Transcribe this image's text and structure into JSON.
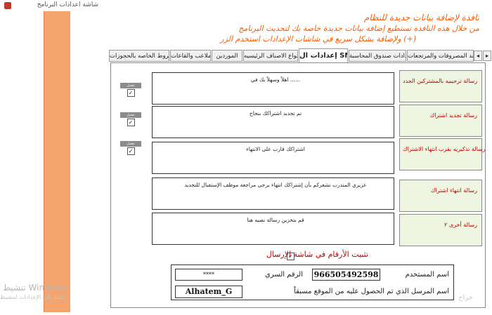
{
  "window": {
    "title": "شاشة اعدادات البرنامج"
  },
  "header": {
    "line1": "نافذة لإضافة بيانات جديدة للنظام",
    "line2": "من خلال هذه النافذة تستطيع إضافة بيانات جديدة خاصة بك لتحديث البرنامج",
    "line3": "ولإضافة بشكل سريع في شاشات الإعدادات استخدم الزر (+)"
  },
  "tabs": [
    {
      "label": "الشروط الخاصه بالحجوزات"
    },
    {
      "label": "الملاعب والقاعات"
    },
    {
      "label": "الموردين"
    },
    {
      "label": "انواع الاصناف الرئيسيه"
    },
    {
      "label": "إعدادات ال SMS",
      "active": true
    },
    {
      "label": "إعدادات صندوق المحاسبة"
    },
    {
      "label": "بند المصروفات والمرتجعات"
    }
  ],
  "nav": {
    "prev": "◂",
    "next": "▸"
  },
  "sms_messages": [
    {
      "label": "رسالة ترحيبيه بالمشتركين الجدد",
      "text": "اهلاً وسهلاً بك في ......",
      "has_toggle": true,
      "toggle_label": "تفعيل",
      "checked": true
    },
    {
      "label": "رسالة تجديد اشتراك",
      "text": "تم تجديد اشتراكك بنجاح",
      "has_toggle": true,
      "toggle_label": "تفعيل",
      "checked": true
    },
    {
      "label": "رسالة تذكيريه بقرب انتهاء الاشتراك",
      "text": "اشتراكك قارب على الانتهاء",
      "has_toggle": true,
      "toggle_label": "تفعيل",
      "checked": true
    },
    {
      "label": "رسالة انتهاء اشتراك",
      "text": "عزيزي المتدرب نشعركم بأن إشتراكك انتهاء يرجى مراجعة موظف الإستقبال للتجديد",
      "has_toggle": false
    },
    {
      "label": "رسالة أخرى ٢",
      "text": "قم بتخزين رسالة نصيه هنا",
      "has_toggle": false
    }
  ],
  "fix_numbers": {
    "label": "تثبيت الأرقام في شاشة الإرسال",
    "checked": true
  },
  "credentials": {
    "username_label": "اسم المستخدم",
    "username_value": "966505492598",
    "password_label": "الرقم السري",
    "password_value": "****",
    "sender_label": "اسم المرسل الذي تم الحصول عليه من الموقع مسبقاً",
    "sender_value": "Alhatem_G"
  },
  "watermark": {
    "windows": "تنشيط Windows",
    "activate": "انتقل إلى الإعدادات لتنشيط",
    "site": "حراج"
  },
  "colors": {
    "accent_orange": "#f4a46f",
    "header_text": "#ff5a00",
    "label_red": "#c00000",
    "label_bg": "#eef5e0"
  }
}
